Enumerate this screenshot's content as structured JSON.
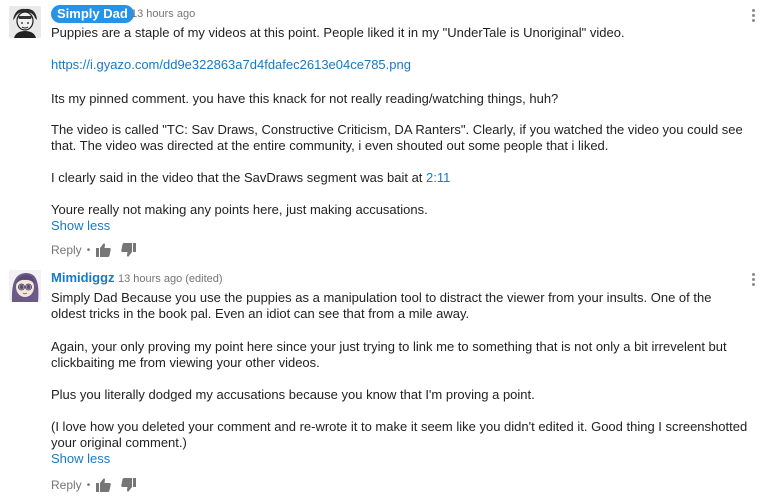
{
  "comments": [
    {
      "author": "Simply Dad",
      "timestamp": "13 hours ago",
      "lines": [
        "Puppies are a staple of my videos at this point. People liked it in my \"UnderTale is Unoriginal\" video.",
        "",
        "https://i.gyazo.com/dd9e322863a7d4fdafec2613e04ce785.png",
        "",
        "Its my pinned comment. you have this knack for not really reading/watching things, huh?",
        "",
        "The video is called \"TC: Sav Draws, Constructive Criticism, DA Ranters\". Clearly, if you watched the video you could see",
        "that. The video was directed at the entire community, i even shouted out some people that i liked.",
        "",
        "I clearly said in the video that the SavDraws segment was bait at",
        "",
        "Youre really not making any points here, just making accusations."
      ],
      "link_url": "https://i.gyazo.com/dd9e322863a7d4fdafec2613e04ce785.png",
      "time_link": "2:11",
      "show_less": "Show less",
      "reply": "Reply"
    },
    {
      "author": "Mimidiggz",
      "timestamp": "13 hours ago (edited)",
      "lines": [
        "Simply Dad Because you use the puppies as a manipulation tool to distract the viewer from your insults. One of the",
        "oldest tricks in the book pal. Even an idiot can see that from a mile away.",
        "",
        "Again, your only proving my point here since your just trying to link me to something that is not only a bit irrevelent but",
        "clickbaiting me from viewing your other videos.",
        "",
        "Plus you literally dodged my accusations because you know that I'm proving a point.",
        "",
        "(I love how you deleted your comment and re-wrote it to make it seem like you didn't edited it. Good thing I screenshotted",
        "your original comment.)"
      ],
      "show_less": "Show less",
      "reply": "Reply"
    }
  ],
  "icons": {
    "thumb_up": "thumb-up-icon",
    "thumb_down": "thumb-down-icon",
    "menu": "more-vert-icon"
  },
  "colors": {
    "link": "#167ac6",
    "badge": "#2793e6",
    "muted": "#767676"
  }
}
